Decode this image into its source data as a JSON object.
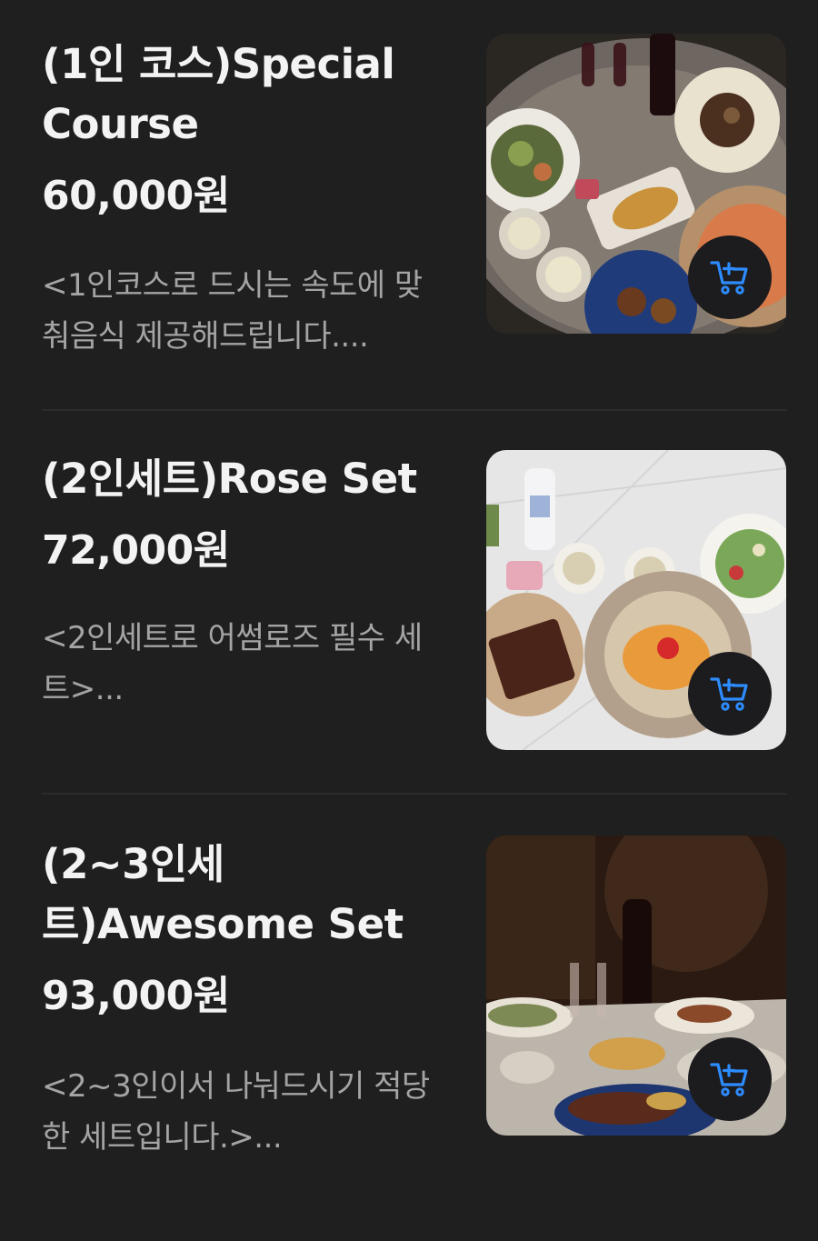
{
  "menu": {
    "items": [
      {
        "title": "(1인 코스)Special Course",
        "price": "60,000원",
        "description": "<1인코스로 드시는 속도에 맞춰음식 제공해드립니다...."
      },
      {
        "title": "(2인세트)Rose Set",
        "price": "72,000원",
        "description": "<2인세트로 어썸로즈 필수 세트>..."
      },
      {
        "title": "(2~3인세트)Awesome Set",
        "price": "93,000원",
        "description": "<2~3인이서 나눠드시기 적당한 세트입니다.>..."
      }
    ]
  },
  "icons": {
    "cart": "add-to-cart-icon"
  },
  "colors": {
    "background": "#1f1f1f",
    "title_text": "#f3f3f3",
    "description_text": "#a4a4a4",
    "cart_icon": "#2d8cff",
    "cart_button_bg": "#1c1c1e"
  }
}
